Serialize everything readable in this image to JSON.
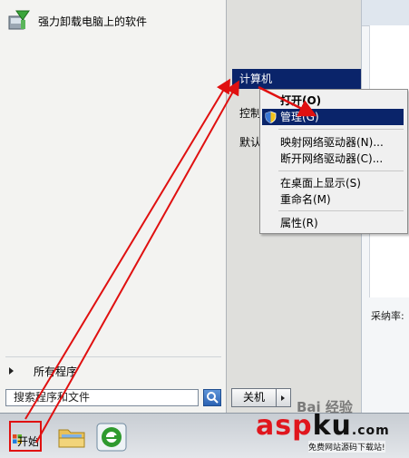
{
  "start_menu": {
    "pinned_program": "强力卸载电脑上的软件",
    "all_programs": "所有程序",
    "search_placeholder": "搜索程序和文件",
    "right_items": {
      "computer": "计算机",
      "control": "控制",
      "default": "默认"
    },
    "shutdown_label": "关机"
  },
  "context_menu": {
    "open": "打开(O)",
    "manage": "管理(G)",
    "map_drive": "映射网络驱动器(N)...",
    "disconnect_drive": "断开网络驱动器(C)...",
    "show_desktop": "在桌面上显示(S)",
    "rename": "重命名(M)",
    "properties": "属性(R)"
  },
  "background_window": {
    "sample_rate_label": "采纳率:"
  },
  "taskbar": {
    "start_label": "开始"
  },
  "watermark": {
    "text_red": "asp",
    "text_black": "ku",
    "suffix": ".com",
    "subtitle": "免费网站源码下载站!",
    "baidu": "Bai 经验"
  },
  "colors": {
    "highlight": "#0a246a",
    "annotation_red": "#e01010"
  }
}
